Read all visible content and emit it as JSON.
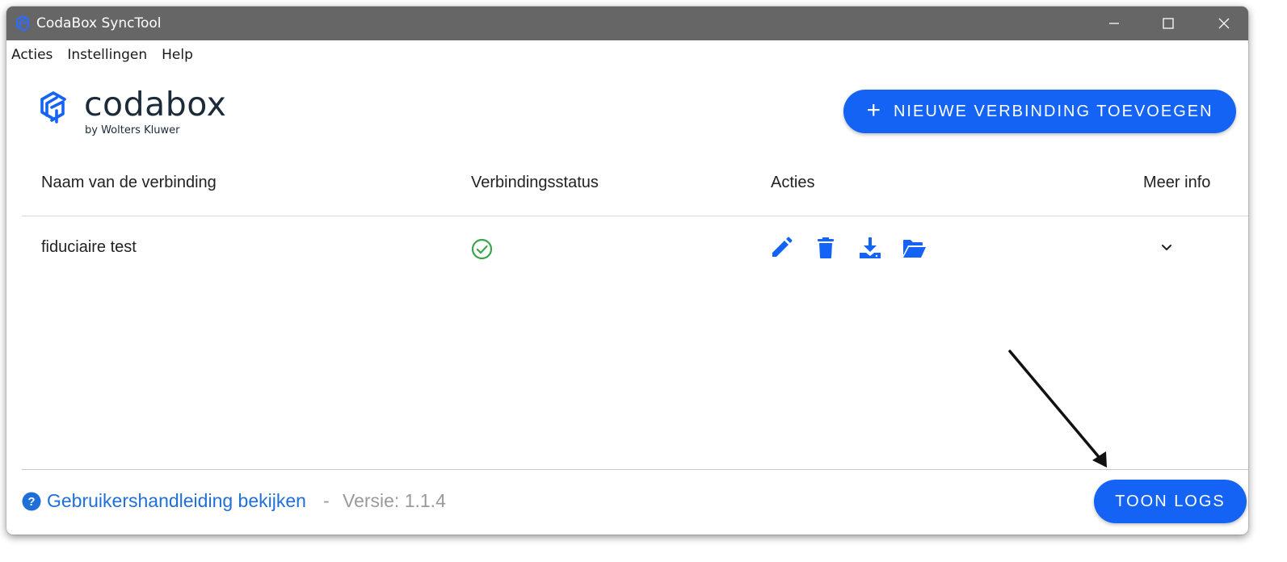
{
  "window": {
    "title": "CodaBox SyncTool",
    "titlebar_color": "#666666"
  },
  "menu": [
    "Acties",
    "Instellingen",
    "Help"
  ],
  "logo": {
    "word": "codabox",
    "sub": "by Wolters Kluwer"
  },
  "add_button": {
    "icon": "plus-icon",
    "label": "NIEUWE VERBINDING TOEVOEGEN"
  },
  "table": {
    "headers": [
      "Naam van de verbinding",
      "Verbindingsstatus",
      "Acties",
      "Meer info"
    ],
    "rows": [
      {
        "name": "fiduciaire test",
        "status_icon": "check-circle-icon",
        "actions": [
          "pencil-icon",
          "trash-icon",
          "download-icon",
          "folder-open-icon"
        ],
        "more_icon": "chevron-down-icon"
      }
    ]
  },
  "footer": {
    "help_link": "Gebruikershandleiding bekijken",
    "separator": "-",
    "version": "Versie: 1.1.4",
    "logs_button": "TOON LOGS"
  },
  "colors": {
    "accent": "#1463f5",
    "link": "#1f6fd8",
    "success": "#3aa54a",
    "muted": "#9a9a9a"
  }
}
